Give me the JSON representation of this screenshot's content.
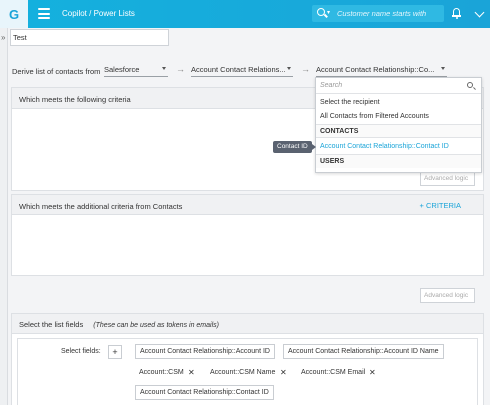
{
  "header": {
    "logo_letter": "G",
    "title": "Copilot / Power Lists",
    "search_placeholder": "Customer name starts with",
    "search_caret": "▾"
  },
  "sidebar": {
    "expand_glyph": "»"
  },
  "list_name": "Test",
  "derive": {
    "label": "Derive list of contacts from",
    "source": "Salesforce",
    "object": "Account Contact Relations...",
    "field": "Account Contact Relationship::Co...",
    "arrow_glyph": "→"
  },
  "criteria_panel": {
    "title": "Which meets the following criteria",
    "advanced_logic_placeholder": "Advanced logic"
  },
  "additional_panel": {
    "title": "Which meets the additional criteria from Contacts",
    "criteria_link": "+ CRITERIA",
    "advanced_logic_placeholder": "Advanced logic"
  },
  "list_fields": {
    "title": "Select the list fields",
    "note": "(These can be used as tokens in emails)",
    "select_label": "Select fields:",
    "plus_label": "+",
    "remove_glyph": "✕",
    "chips": [
      "Account Contact Relationship::Account ID",
      "Account Contact Relationship::Account ID Name",
      "Account Contact Relationship::Contact ID"
    ],
    "plain_fields": [
      "Account::CSM",
      "Account::CSM Name",
      "Account::CSM Email"
    ]
  },
  "dropdown": {
    "search_placeholder": "Search",
    "items": [
      "Select the recipient",
      "All Contacts from Filtered Accounts",
      "CONTACTS",
      "Account Contact Relationship::Contact ID",
      "USERS"
    ]
  },
  "tooltip": "Contact ID",
  "colors": {
    "brand": "#1aa4d8",
    "active_item": "#1aa4d8"
  }
}
